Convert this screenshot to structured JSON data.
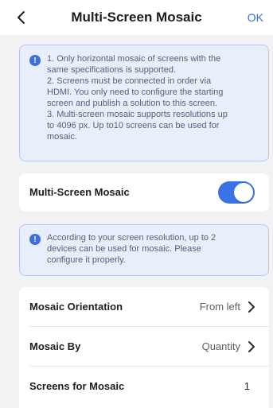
{
  "header": {
    "title": "Multi-Screen Mosaic",
    "ok_label": "OK",
    "back_icon": "chevron-left-icon"
  },
  "info_box": {
    "icon": "info-icon",
    "lines": [
      "1. Only horizontal mosaic of screens with the",
      "same specifications is supported.",
      "2. Screens must be connected in order via",
      "HDMI. You only need to configure the starting",
      "screen and publish a solution to this screen.",
      "3. Multi-screen mosaic supports resolutions up",
      "to 4096 px. Up to10 screens can be used for",
      "mosaic."
    ]
  },
  "mosaic_toggle": {
    "label": "Multi-Screen Mosaic",
    "enabled": true
  },
  "resolution_note": {
    "icon": "info-icon",
    "lines": [
      "According to your screen resolution, up to 2",
      "devices can be used for mosaic. Please",
      "configure it properly."
    ]
  },
  "settings": {
    "orientation": {
      "label": "Mosaic Orientation",
      "value": "From left"
    },
    "mosaic_by": {
      "label": "Mosaic By",
      "value": "Quantity"
    },
    "screens": {
      "label": "Screens for Mosaic",
      "value": "1"
    }
  },
  "colors": {
    "accent": "#3b72e6",
    "info_background": "#e9eefb",
    "info_border": "#b7c8ee",
    "page_background": "#f2f2f4"
  }
}
